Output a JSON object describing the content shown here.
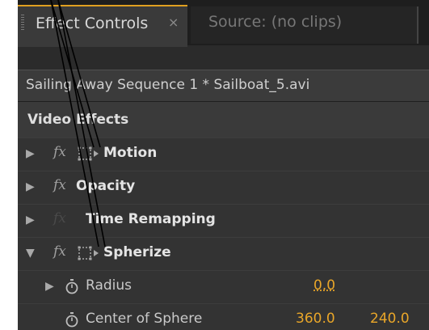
{
  "tabs": [
    {
      "label": "Effect Controls",
      "close": "×"
    },
    {
      "label": "Source: (no clips)"
    }
  ],
  "sequence_label": "Sailing Away Sequence 1 * Sailboat_5.avi",
  "section_label": "Video Effects",
  "effects": [
    {
      "name": "Motion",
      "expanded": false,
      "icon": "transform-icon"
    },
    {
      "name": "Opacity",
      "expanded": false
    },
    {
      "name": "Time Remapping",
      "expanded": false
    },
    {
      "name": "Spherize",
      "expanded": true,
      "icon": "transform-icon"
    }
  ],
  "fx_label": "fx",
  "properties": [
    {
      "name": "Radius",
      "value": "0.0"
    },
    {
      "name": "Center of Sphere",
      "value_x": "360.0",
      "value_y": "240.0"
    }
  ],
  "colors": {
    "accent": "#e0a020",
    "value": "#e9a629",
    "panel": "#2b2b2b"
  }
}
